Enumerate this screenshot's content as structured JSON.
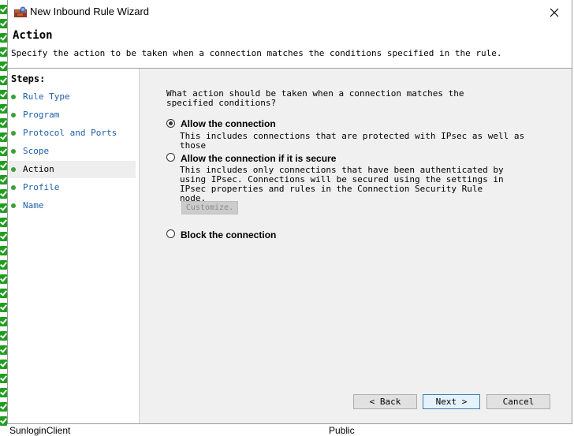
{
  "window": {
    "title": "New Inbound Rule Wizard"
  },
  "header": {
    "title": "Action",
    "description": "Specify the action to be taken when a connection matches the conditions specified in the rule."
  },
  "steps": {
    "title": "Steps:",
    "items": [
      {
        "label": "Rule Type"
      },
      {
        "label": "Program"
      },
      {
        "label": "Protocol and Ports"
      },
      {
        "label": "Scope"
      },
      {
        "label": "Action"
      },
      {
        "label": "Profile"
      },
      {
        "label": "Name"
      }
    ],
    "current": "Action"
  },
  "content": {
    "question": "What action should be taken when a connection matches the specified conditions?",
    "options": [
      {
        "label": "Allow the connection",
        "description": "This includes connections that are protected with IPsec as well as those",
        "selected": true
      },
      {
        "label": "Allow the connection if it is secure",
        "description": "This includes only connections that have been authenticated by using IPsec.  Connections will be secured using the settings in IPsec properties and rules in the Connection Security Rule node.",
        "selected": false
      },
      {
        "label": "Block the connection",
        "description": "",
        "selected": false
      }
    ],
    "customize_label": "Customize.",
    "customize_enabled": false
  },
  "buttons": {
    "back": "< Back",
    "next": "Next >",
    "cancel": "Cancel"
  },
  "background": {
    "row_text": "SunloginClient",
    "row_profile": "Public"
  },
  "colors": {
    "link": "#2060a8",
    "step_bullet": "#3aa03a",
    "content_bg": "#f0f0f0",
    "check_green": "#1e9e1e"
  }
}
